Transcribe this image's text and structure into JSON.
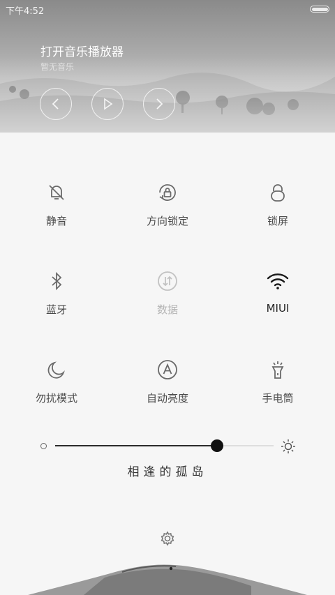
{
  "status_bar": {
    "time": "下午4:52"
  },
  "music": {
    "title": "打开音乐播放器",
    "subtitle": "暂无音乐",
    "controls": [
      "previous-icon",
      "play-icon",
      "next-icon"
    ]
  },
  "toggles": [
    {
      "label": "静音",
      "icon": "bell-off-icon",
      "state": "normal"
    },
    {
      "label": "方向锁定",
      "icon": "rotation-lock-icon",
      "state": "normal"
    },
    {
      "label": "锁屏",
      "icon": "lock-icon",
      "state": "normal"
    },
    {
      "label": "蓝牙",
      "icon": "bluetooth-icon",
      "state": "normal"
    },
    {
      "label": "数据",
      "icon": "mobile-data-icon",
      "state": "disabled"
    },
    {
      "label": "MIUI",
      "icon": "wifi-icon",
      "state": "active"
    },
    {
      "label": "勿扰模式",
      "icon": "moon-icon",
      "state": "normal"
    },
    {
      "label": "自动亮度",
      "icon": "auto-brightness-icon",
      "state": "normal"
    },
    {
      "label": "手电筒",
      "icon": "flashlight-icon",
      "state": "normal"
    }
  ],
  "brightness": {
    "level": 0.74
  },
  "caption": "相逢的孤岛",
  "settings_icon": "gear-icon"
}
